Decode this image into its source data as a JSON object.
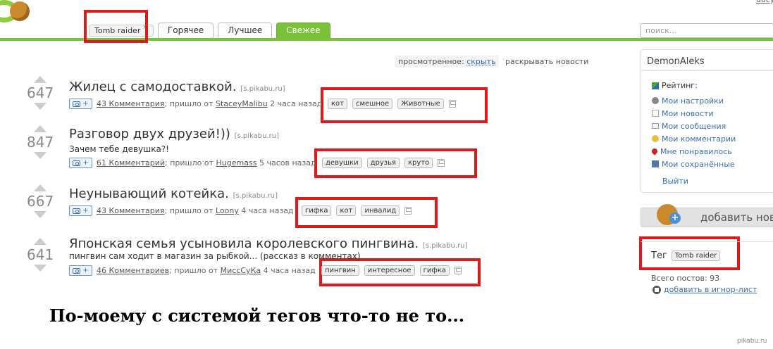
{
  "header": {
    "tabs": [
      {
        "label": "Tomb raider",
        "close": "×"
      },
      {
        "label": "Горячее"
      },
      {
        "label": "Лучшее"
      },
      {
        "label": "Свежее"
      }
    ],
    "search_placeholder": "поиск...",
    "top_right": "docy"
  },
  "controls": {
    "viewed_label": "просмотренное:",
    "viewed_action": "скрыть",
    "expand": "раскрывать новости"
  },
  "stories": [
    {
      "score": "647",
      "title": "Жилец с самодоставкой.",
      "source": "[s.pikabu.ru]",
      "description": "",
      "comments": "43 Комментария",
      "posted_prefix": "; пришло от",
      "author": "StaceyMalibu",
      "time": "2 часа назад",
      "tags": [
        "кот",
        "смешное",
        "Животные"
      ]
    },
    {
      "score": "847",
      "title": "Разговор двух друзей!))",
      "source": "[s.pikabu.ru]",
      "description": "Зачем тебе девушка?!",
      "comments": "61 Комментарий",
      "posted_prefix": "; пришло от",
      "author": "Hugemass",
      "time": "5 часов назад",
      "tags": [
        "девушки",
        "друзья",
        "круто"
      ]
    },
    {
      "score": "667",
      "title": "Неунывающий котейка.",
      "source": "[s.pikabu.ru]",
      "description": "",
      "comments": "43 Комментария",
      "posted_prefix": "; пришло от",
      "author": "Loony",
      "time": "4 часа назад",
      "tags": [
        "гифка",
        "кот",
        "инвалид"
      ]
    },
    {
      "score": "641",
      "title": "Японская семья усыновила королевского пингвина.",
      "source": "[s.pikabu.ru]",
      "description": "пингвин сам ходит в магазин за рыбкой... (рассказ в комментах)",
      "comments": "46 Комментариев",
      "posted_prefix": "; пришло от",
      "author": "МиссСуКа",
      "time": "4 часа назад",
      "tags": [
        "пингвин",
        "интересное",
        "гифка"
      ]
    }
  ],
  "caption": "По-моему с системой тегов что-то не то...",
  "watermark": "pikabu.ru",
  "sidebar": {
    "username": "DemonAleks",
    "rating_label": "Рейтинг:",
    "links": [
      {
        "label": "Мои настройки",
        "icon": "gear-icon",
        "color": "#888888"
      },
      {
        "label": "Мои новости",
        "icon": "document-icon",
        "color": "#aaaaaa"
      },
      {
        "label": "Мои сообщения",
        "icon": "envelope-icon",
        "color": "#999999"
      },
      {
        "label": "Мои комментарии",
        "icon": "speech-bubble-icon",
        "color": "#e8c040"
      },
      {
        "label": "Мне понравилось",
        "icon": "heart-icon",
        "color": "#d02020"
      },
      {
        "label": "Мои сохранённые",
        "icon": "floppy-icon",
        "color": "#5577aa"
      }
    ],
    "logout": "Выйти",
    "add_news": "добавить нов",
    "tag_label": "Тег",
    "tag_value": "Tomb raider",
    "total_posts": "Всего постов: 93",
    "ignore_link": "добавить в игнор-лист"
  },
  "colors": {
    "brand_green": "#7cc13a",
    "link_blue": "#3a6fb0",
    "highlight_red": "#e01a1a"
  }
}
